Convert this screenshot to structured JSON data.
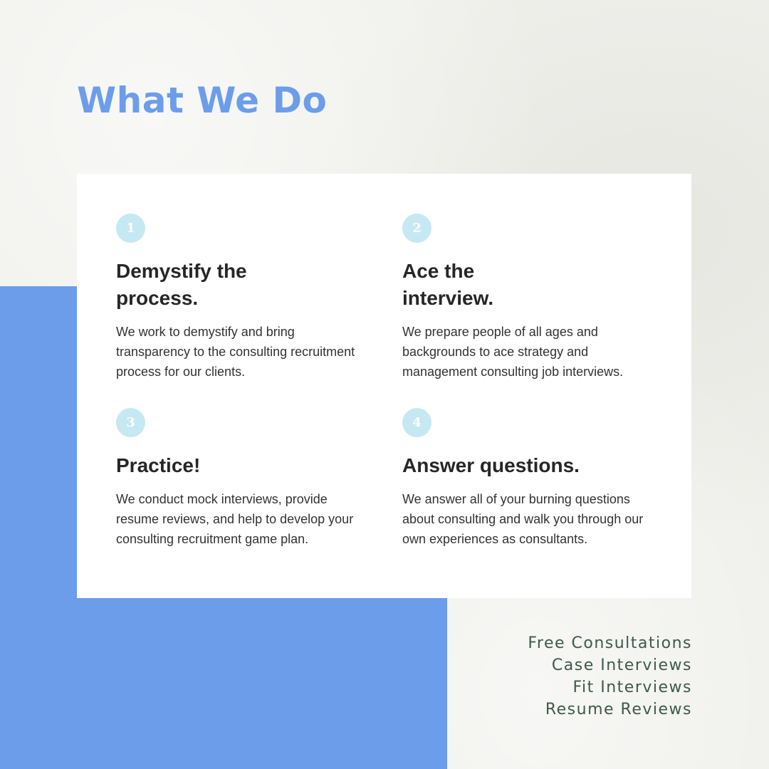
{
  "page": {
    "title": "What We Do",
    "colors": {
      "background": "#efefeb",
      "accent_blue": "#6c9dea",
      "badge": "#c6e8f3",
      "heading_text": "#262626",
      "services_text": "#3e5a4c"
    }
  },
  "features": [
    {
      "number": "1",
      "title": "Demystify the process.",
      "description": "We work to demystify and bring transparency to the consulting recruitment process for our clients."
    },
    {
      "number": "2",
      "title": "Ace the interview.",
      "description": "We prepare people of all ages and backgrounds to ace strategy and management consulting job interviews."
    },
    {
      "number": "3",
      "title": "Practice!",
      "description": "We conduct mock interviews, provide resume reviews, and help to develop your consulting recruitment game plan."
    },
    {
      "number": "4",
      "title": "Answer questions.",
      "description": "We answer all of your burning questions about consulting and walk you through our own experiences as consultants."
    }
  ],
  "services": [
    "Free Consultations",
    "Case Interviews",
    "Fit Interviews",
    "Resume Reviews"
  ]
}
